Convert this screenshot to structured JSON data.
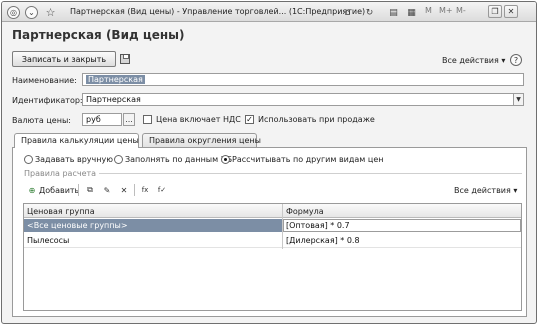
{
  "window": {
    "title": "Партнерская (Вид цены) - Управление торговлей... (1С:Предприятие)",
    "right_letters": [
      "M",
      "M+",
      "M-"
    ]
  },
  "form": {
    "title": "Партнерская (Вид цены)",
    "save_close_label": "Записать и закрыть",
    "all_actions_label": "Все действия ▾",
    "help_label": "?"
  },
  "fields": {
    "name_label": "Наименование:",
    "name_value": "Партнерская",
    "id_label": "Идентификатор:",
    "id_value": "Партнерская",
    "currency_label": "Валюта цены:",
    "currency_value": "руб",
    "vat_label": "Цена включает НДС",
    "vat_checked": false,
    "use_in_sales_label": "Использовать при продаже",
    "use_in_sales_checked": true
  },
  "tabs": [
    {
      "label": "Правила калькуляции цены",
      "active": true
    },
    {
      "label": "Правила округления цены",
      "active": false
    }
  ],
  "calc_options": [
    {
      "label": "Задавать вручную",
      "selected": false
    },
    {
      "label": "Заполнять по данным ИБ",
      "selected": false
    },
    {
      "label": "Рассчитывать по другим видам цен",
      "selected": true
    }
  ],
  "rules": {
    "group_title": "Правила расчета",
    "add_label": "Добавить",
    "all_actions_label": "Все действия ▾",
    "columns": [
      "Ценовая группа",
      "Формула"
    ],
    "rows": [
      {
        "group": "<Все ценовые группы>",
        "formula": "[Оптовая] * 0.7",
        "selected": true
      },
      {
        "group": "Пылесосы",
        "formula": "[Дилерская] * 0.8",
        "selected": false
      }
    ]
  },
  "icons": {
    "app": "app-logo-icon",
    "back": "back-icon",
    "favorite": "star-icon",
    "add": "add-icon",
    "copy": "copy-icon",
    "edit": "pencil-icon",
    "delete": "delete-icon",
    "formula1": "formula-edit-icon",
    "formula2": "formula-check-icon"
  }
}
